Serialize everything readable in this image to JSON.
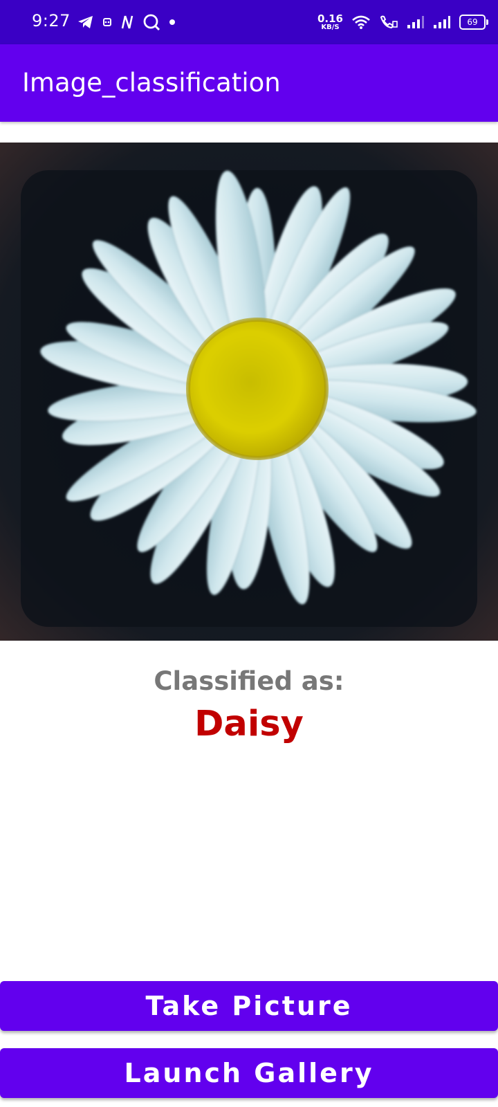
{
  "status_bar": {
    "time": "9:27",
    "net_speed_value": "0.16",
    "net_speed_unit": "KB/S",
    "battery_level": "69",
    "left_icons": [
      "telegram-icon",
      "notification-icon",
      "n-app-icon",
      "search-app-icon",
      "dot-icon"
    ],
    "right_icons": [
      "wifi-icon",
      "volte-call-icon",
      "signal-icon",
      "signal-icon"
    ]
  },
  "app_bar": {
    "title": "Image_classification",
    "color": "#6200ee"
  },
  "image": {
    "subject": "daisy-photo"
  },
  "classification": {
    "caption": "Classified as:",
    "result": "Daisy",
    "result_color": "#c10000"
  },
  "actions": {
    "take_picture": "Take Picture",
    "launch_gallery": "Launch Gallery"
  }
}
